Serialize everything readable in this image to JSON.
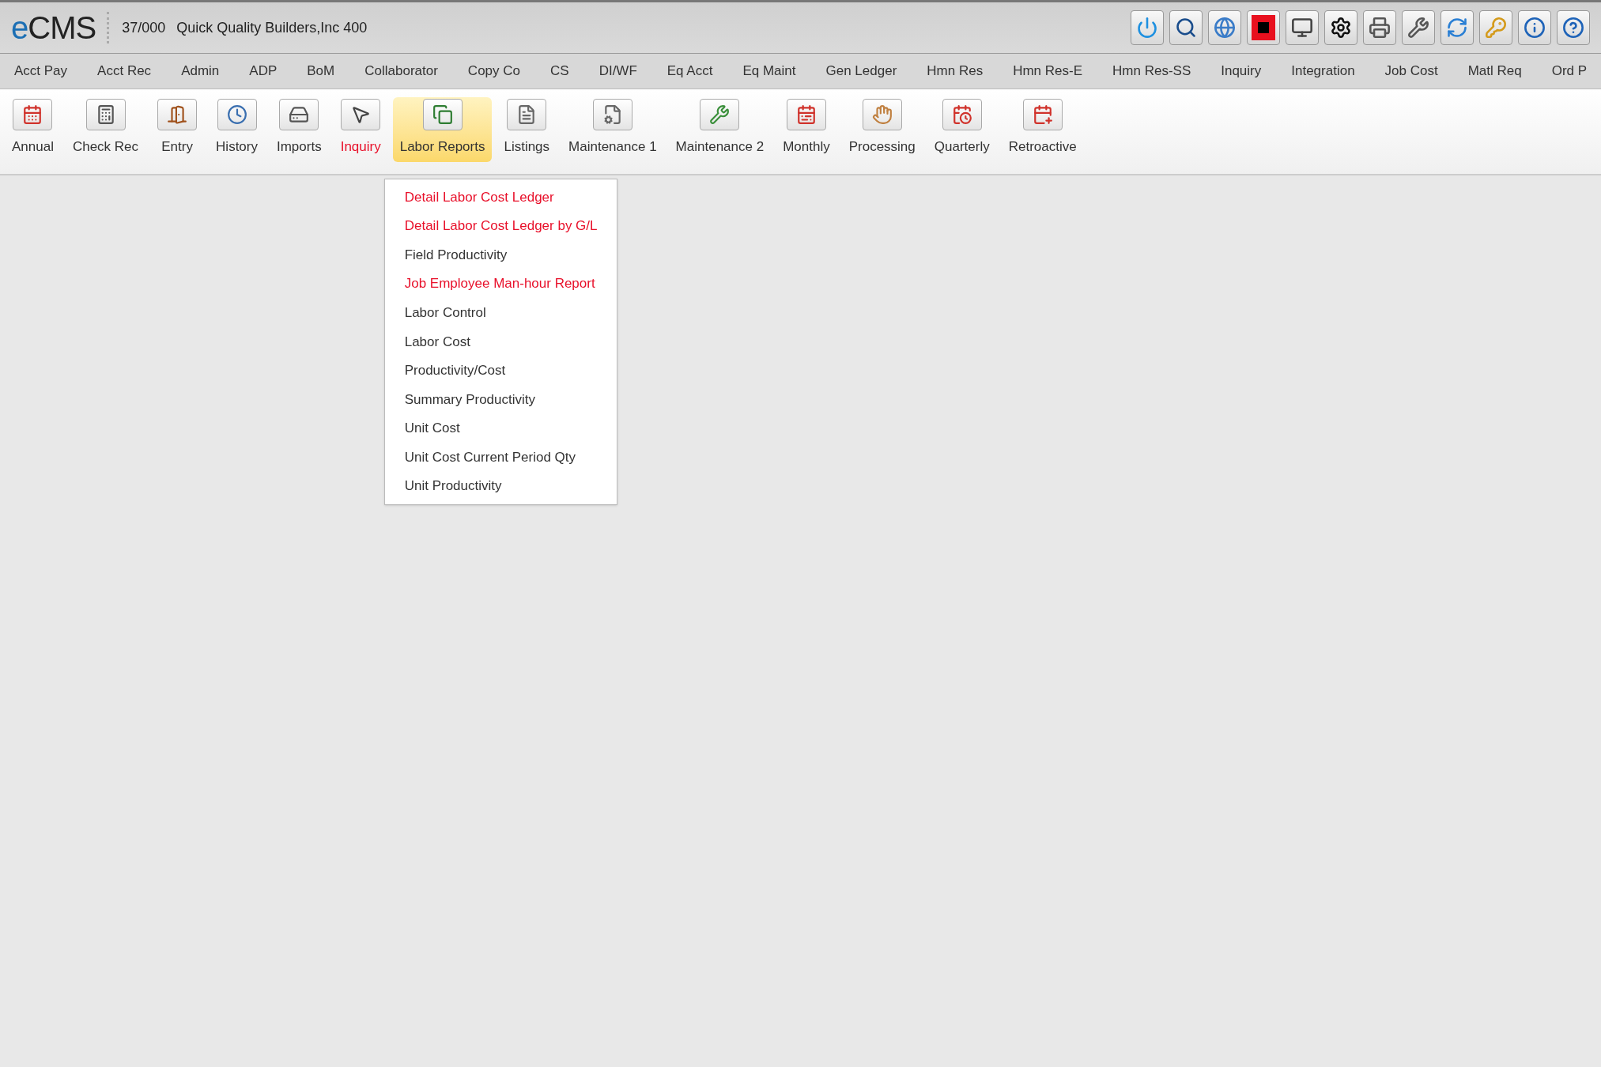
{
  "header": {
    "logo": {
      "accent": "e",
      "text": "CMS"
    },
    "company_code": "37/000",
    "company_name": "Quick Quality Builders,Inc 400"
  },
  "main_menu": [
    {
      "label": "Acct Pay"
    },
    {
      "label": "Acct Rec"
    },
    {
      "label": "Admin"
    },
    {
      "label": "ADP"
    },
    {
      "label": "BoM"
    },
    {
      "label": "Collaborator"
    },
    {
      "label": "Copy Co"
    },
    {
      "label": "CS"
    },
    {
      "label": "DI/WF"
    },
    {
      "label": "Eq Acct"
    },
    {
      "label": "Eq Maint"
    },
    {
      "label": "Gen Ledger"
    },
    {
      "label": "Hmn Res"
    },
    {
      "label": "Hmn Res-E"
    },
    {
      "label": "Hmn Res-SS"
    },
    {
      "label": "Inquiry"
    },
    {
      "label": "Integration"
    },
    {
      "label": "Job Cost"
    },
    {
      "label": "Matl Req"
    },
    {
      "label": "Ord P"
    }
  ],
  "toolbar": [
    {
      "label": "Annual",
      "selected": false,
      "highlighted": false
    },
    {
      "label": "Check Rec",
      "selected": false,
      "highlighted": false
    },
    {
      "label": "Entry",
      "selected": false,
      "highlighted": false
    },
    {
      "label": "History",
      "selected": false,
      "highlighted": false
    },
    {
      "label": "Imports",
      "selected": false,
      "highlighted": false
    },
    {
      "label": "Inquiry",
      "selected": false,
      "highlighted": true
    },
    {
      "label": "Labor Reports",
      "selected": true,
      "highlighted": false
    },
    {
      "label": "Listings",
      "selected": false,
      "highlighted": false
    },
    {
      "label": "Maintenance 1",
      "selected": false,
      "highlighted": false
    },
    {
      "label": "Maintenance 2",
      "selected": false,
      "highlighted": false
    },
    {
      "label": "Monthly",
      "selected": false,
      "highlighted": false
    },
    {
      "label": "Processing",
      "selected": false,
      "highlighted": false
    },
    {
      "label": "Quarterly",
      "selected": false,
      "highlighted": false
    },
    {
      "label": "Retroactive",
      "selected": false,
      "highlighted": false
    }
  ],
  "dropdown": {
    "items": [
      {
        "label": "Detail Labor Cost Ledger",
        "highlighted": true
      },
      {
        "label": "Detail Labor Cost Ledger by G/L",
        "highlighted": true
      },
      {
        "label": "Field Productivity",
        "highlighted": false
      },
      {
        "label": "Job Employee Man-hour Report",
        "highlighted": true
      },
      {
        "label": "Labor Control",
        "highlighted": false
      },
      {
        "label": "Labor Cost",
        "highlighted": false
      },
      {
        "label": "Productivity/Cost",
        "highlighted": false
      },
      {
        "label": "Summary Productivity",
        "highlighted": false
      },
      {
        "label": "Unit Cost",
        "highlighted": false
      },
      {
        "label": "Unit Cost Current Period Qty",
        "highlighted": false
      },
      {
        "label": "Unit Productivity",
        "highlighted": false
      }
    ]
  }
}
